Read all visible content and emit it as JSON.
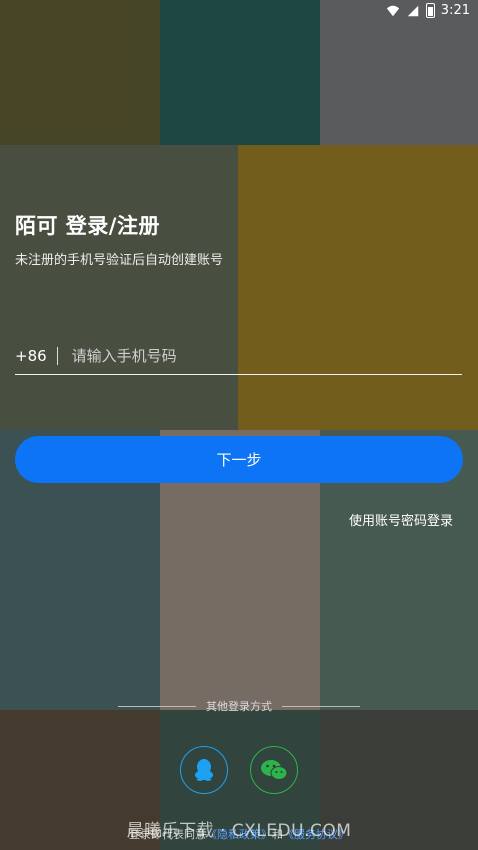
{
  "status_bar": {
    "time": "3:21"
  },
  "header": {
    "title": "陌可 登录/注册",
    "subtitle": "未注册的手机号验证后自动创建账号"
  },
  "phone": {
    "country_code": "+86",
    "placeholder": "请输入手机号码",
    "value": ""
  },
  "actions": {
    "next_label": "下一步",
    "password_login_label": "使用账号密码登录"
  },
  "other_login": {
    "label": "其他登录方式",
    "providers": [
      "qq-icon",
      "wechat-icon"
    ]
  },
  "agreement": {
    "prefix": "登录即代表同意",
    "privacy": "《隐私政策》",
    "and": "和",
    "terms": "《服务协议》"
  },
  "watermark": "晨曦乐下载 · CXLEDU.COM",
  "colors": {
    "primary": "#0c74f5",
    "qq": "#1da1f2",
    "wechat": "#2ab54a"
  }
}
